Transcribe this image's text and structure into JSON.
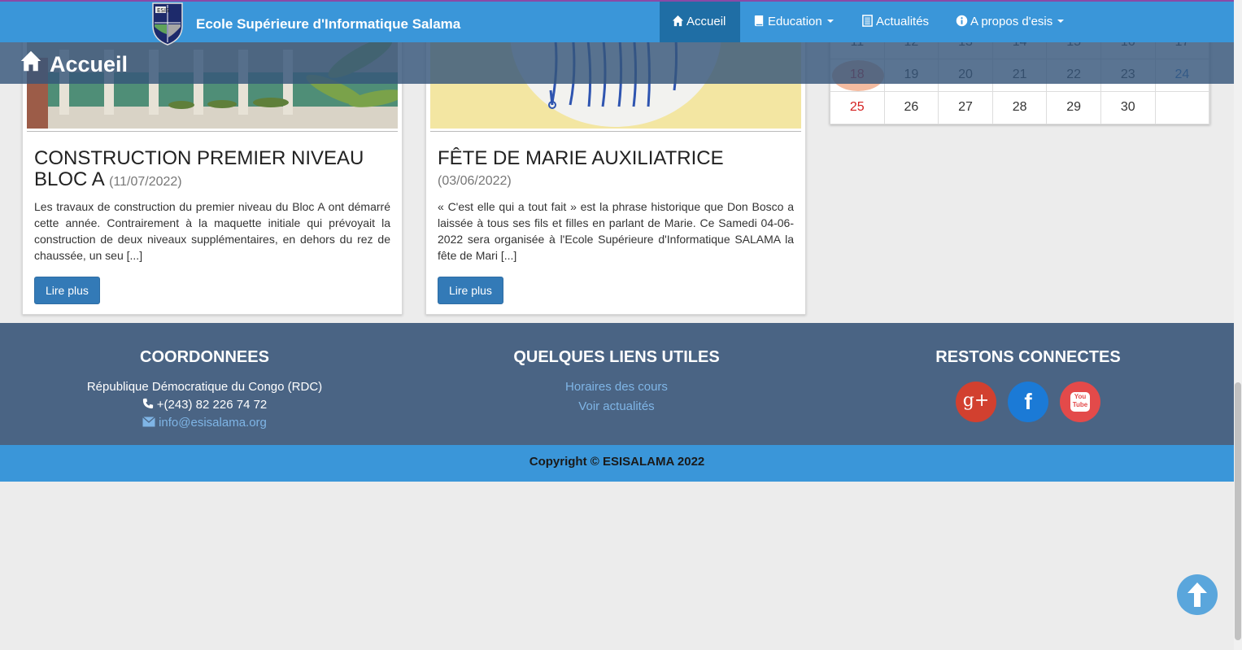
{
  "navbar": {
    "brand_name": "Ecole Supérieure d'Informatique Salama",
    "logo_letters": "ESIS",
    "items": [
      {
        "label": "Accueil",
        "icon": "home-icon",
        "active": true
      },
      {
        "label": "Education",
        "icon": "book-icon",
        "dropdown": true
      },
      {
        "label": "Actualités",
        "icon": "newspaper-icon"
      },
      {
        "label": "A propos d'esis",
        "icon": "info-icon",
        "dropdown": true
      }
    ]
  },
  "page_header": {
    "title": "Accueil",
    "icon": "home-icon"
  },
  "articles": [
    {
      "title": "CONSTRUCTION PREMIER NIVEAU BLOC A",
      "date": "(11/07/2022)",
      "excerpt": "Les travaux de construction du premier niveau du Bloc A ont démarré cette année. Contrairement à la maquette initiale qui prévoyait la construction de deux niveaux supplémentaires, en dehors du rez de chaussée, un seu [...]",
      "button": "Lire plus"
    },
    {
      "title": "FÊTE DE MARIE AUXILIATRICE",
      "date": "(03/06/2022)",
      "excerpt": "« C'est elle qui a tout fait » est la phrase historique que Don Bosco a laissée à tous ses fils et filles en parlant de Marie. Ce Samedi 04-06-2022 sera organisée à l'Ecole Supérieure d'Informatique SALAMA la fête de Mari [...]",
      "button": "Lire plus"
    }
  ],
  "calendar": {
    "partial_row": [
      "11",
      "12",
      "13",
      "14",
      "15",
      "16",
      "17"
    ],
    "rows": [
      [
        "18",
        "19",
        "20",
        "21",
        "22",
        "23",
        "24"
      ],
      [
        "25",
        "26",
        "27",
        "28",
        "29",
        "30",
        ""
      ]
    ],
    "today": "18",
    "colors": {
      "sunday": "#d42020",
      "saturday": "#2a6fc1",
      "today_bg": "#f3b496"
    }
  },
  "footer": {
    "contact": {
      "heading": "COORDONNEES",
      "address": "République Démocratique du Congo (RDC)",
      "phone": "+(243) 82 226 74 72",
      "email": "info@esisalama.org"
    },
    "links": {
      "heading": "QUELQUES LIENS UTILES",
      "items": [
        "Horaires des cours",
        "Voir actualités"
      ]
    },
    "social": {
      "heading": "RESTONS CONNECTES",
      "items": [
        {
          "name": "google-plus-icon",
          "label": "g+",
          "color": "#d2402f"
        },
        {
          "name": "facebook-icon",
          "label": "f",
          "color": "#1b7ad6"
        },
        {
          "name": "youtube-icon",
          "label": "You Tube",
          "color": "#e34a4a"
        }
      ]
    },
    "copyright": "Copyright © ESISALAMA 2022"
  },
  "colors": {
    "nav": "#3a96d9",
    "footer": "#4a6484",
    "button": "#337ab7",
    "link": "#7fb5e6"
  }
}
